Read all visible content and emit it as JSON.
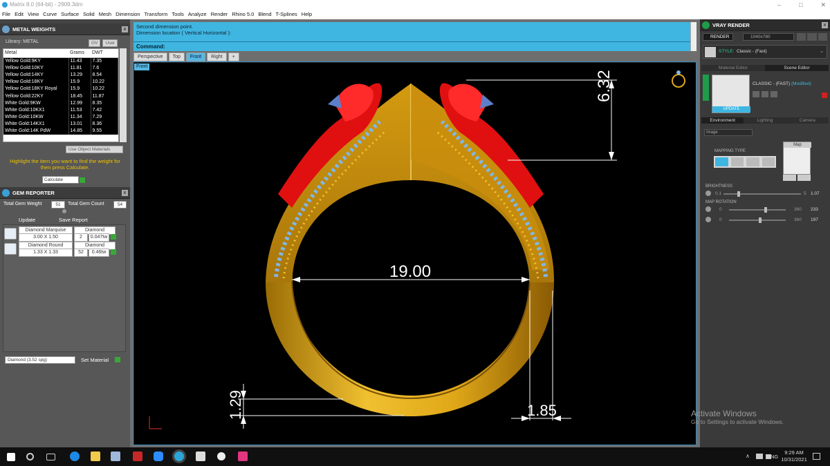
{
  "window": {
    "title": "Matrix 8.0 (64-bit) - 2909.3dm",
    "min": "–",
    "max": "□",
    "close": "✕"
  },
  "menu": [
    "File",
    "Edit",
    "View",
    "Curve",
    "Surface",
    "Solid",
    "Mesh",
    "Dimension",
    "Transform",
    "Tools",
    "Analyze",
    "Render",
    "Rhino 5.0",
    "Blend",
    "T-Splines",
    "Help"
  ],
  "metal_weights": {
    "title": "METAL WEIGHTS",
    "library": "Library: METAL",
    "gv": "GV",
    "user": "User",
    "headers": [
      "Metal",
      "Grams",
      "DWT"
    ],
    "rows": [
      [
        "Yellow Gold:9KY",
        "11.43",
        "7.35"
      ],
      [
        "Yellow Gold:10KY",
        "11.81",
        "7.6"
      ],
      [
        "Yellow Gold:14KY",
        "13.29",
        "8.54"
      ],
      [
        "Yellow Gold:18KY",
        "15.9",
        "10.22"
      ],
      [
        "Yellow Gold:18KY Royal",
        "15.9",
        "10.22"
      ],
      [
        "Yellow Gold:22KY",
        "18.45",
        "11.87"
      ],
      [
        "White Gold:9KW",
        "12.99",
        "8.35"
      ],
      [
        "White Gold:10KX1",
        "11.53",
        "7.42"
      ],
      [
        "White Gold:10KW",
        "11.34",
        "7.29"
      ],
      [
        "White Gold:14KX1",
        "13.01",
        "8.36"
      ],
      [
        "White Gold:14K PdW",
        "14.85",
        "9.55"
      ]
    ],
    "use_object_materials": "Use Object Materials",
    "hint": "Highlight the item you want to find the weight for then press Calculate.",
    "calculate": "Calculate"
  },
  "gem_reporter": {
    "title": "GEM REPORTER",
    "total_weight_label": "Total Gem Weight",
    "total_weight": "51",
    "total_count_label": "Total Gem Count",
    "total_count": "54",
    "update": "Update",
    "save_report": "Save Report",
    "gems": [
      {
        "shape": "Diamond Marquise",
        "size": "3.00 X 1.50",
        "material": "Diamond",
        "count": "2",
        "weight": "0.047tw"
      },
      {
        "shape": "Diamond Round",
        "size": "1.33 X 1.33",
        "material": "Diamond",
        "count": "52",
        "weight": "0.46tw"
      }
    ],
    "material_select": "Diamond    (3.52 spg)",
    "set_material": "Set Material"
  },
  "prompt": {
    "line1": "Second dimension point.",
    "line2": "Dimension location ( Vertical  Horizontal ):",
    "command_label": "Command:"
  },
  "viewport_tabs": [
    "Perspective",
    "Top",
    "Front",
    "Right",
    "+"
  ],
  "active_view": "Front",
  "dimensions": {
    "inner": "19.00",
    "top": "6.32",
    "bottom": "1.29",
    "side": "1.85"
  },
  "vray": {
    "title": "VRAY RENDER",
    "render": "RENDER",
    "resolution": "1040x780",
    "style_label": "STYLE:",
    "style": "Classic - (Fast)",
    "tabs": [
      "Material Editor",
      "Scene Editor"
    ],
    "preset": "CLASSIC - (FAST)",
    "modified": "(Modified)",
    "update": "UPDATE",
    "subtabs": [
      "Environment",
      "Lighting",
      "Camera"
    ],
    "env_select": "Image",
    "map_label": "Map",
    "mapping_type": "MAPPING TYPE",
    "brightness": {
      "label": "BRIGHTNESS",
      "min": "0.1",
      "max": "5",
      "value": "1.07",
      "frac": 0.2
    },
    "map_rotation": "MAP ROTATION",
    "rot1": {
      "min": "0",
      "max": "360",
      "value": "233",
      "frac": 0.65
    },
    "rot2": {
      "min": "0",
      "max": "360",
      "value": "197",
      "frac": 0.55
    }
  },
  "watermark": {
    "line1": "Activate Windows",
    "line2": "Go to Settings to activate Windows."
  },
  "taskbar": {
    "lang": "ENG",
    "time": "9:29 AM",
    "date": "10/31/2021",
    "up": "∧"
  },
  "colors": {
    "accent": "#3fb6e1",
    "gold": "#e0a818",
    "ring_red": "#e01010",
    "gem_blue": "#6fa8dc"
  }
}
